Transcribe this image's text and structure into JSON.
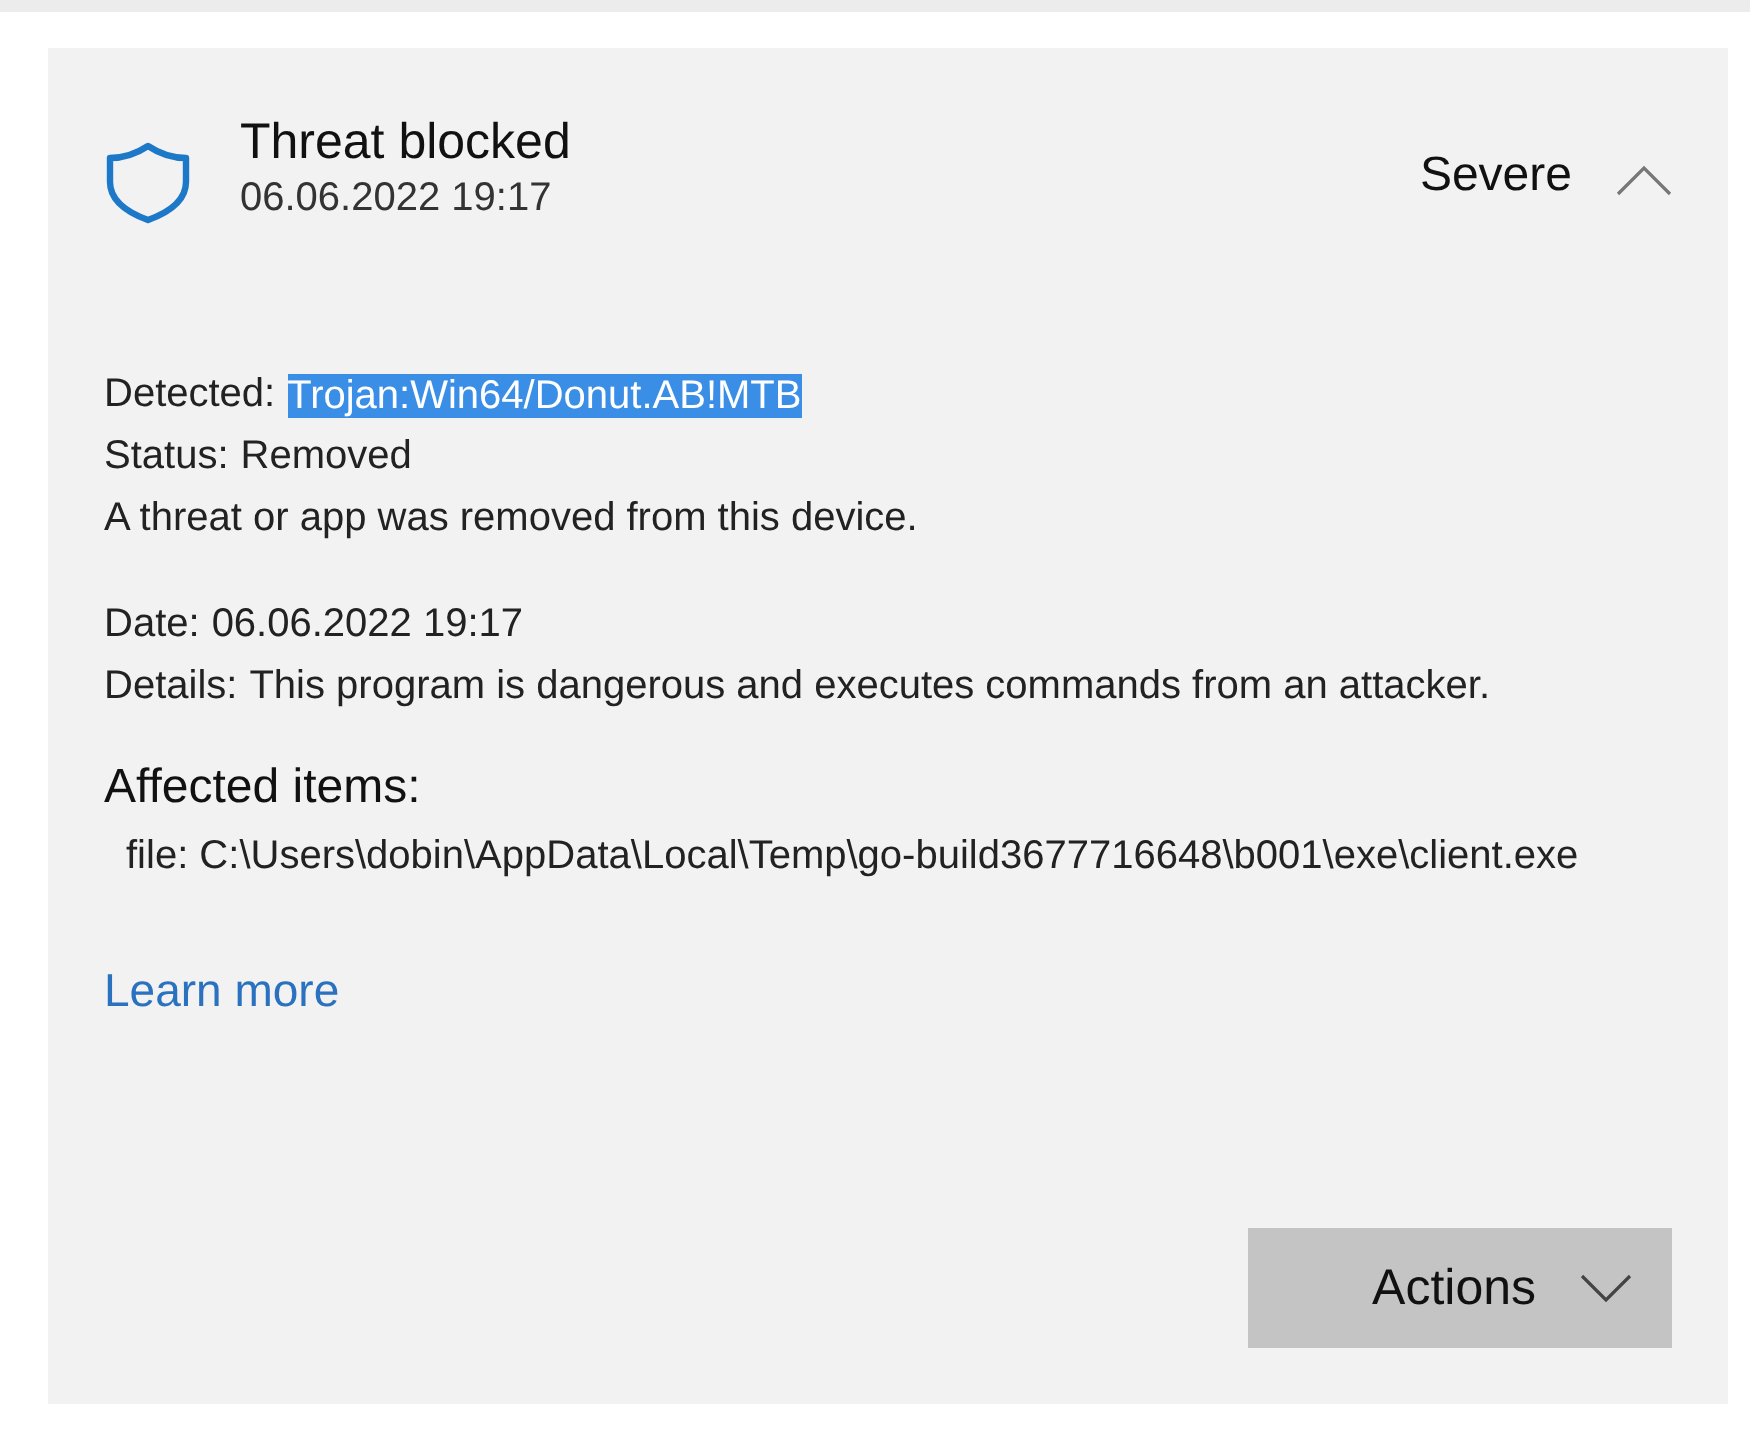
{
  "threat": {
    "title": "Threat blocked",
    "timestamp": "06.06.2022 19:17",
    "severity": "Severe",
    "expanded": true
  },
  "details": {
    "detected_label": "Detected:",
    "detected_value": "Trojan:Win64/Donut.AB!MTB",
    "detected_highlighted": true,
    "status_label": "Status:",
    "status_value": "Removed",
    "status_message": "A threat or app was removed from this device.",
    "date_label": "Date:",
    "date_value": "06.06.2022 19:17",
    "details_label": "Details:",
    "details_value": "This program is dangerous and executes commands from an attacker."
  },
  "affected": {
    "heading": "Affected items:",
    "items": [
      "file: C:\\Users\\dobin\\AppData\\Local\\Temp\\go-build3677716648\\b001\\exe\\client.exe"
    ]
  },
  "learn_more": "Learn more",
  "actions_button": "Actions"
}
